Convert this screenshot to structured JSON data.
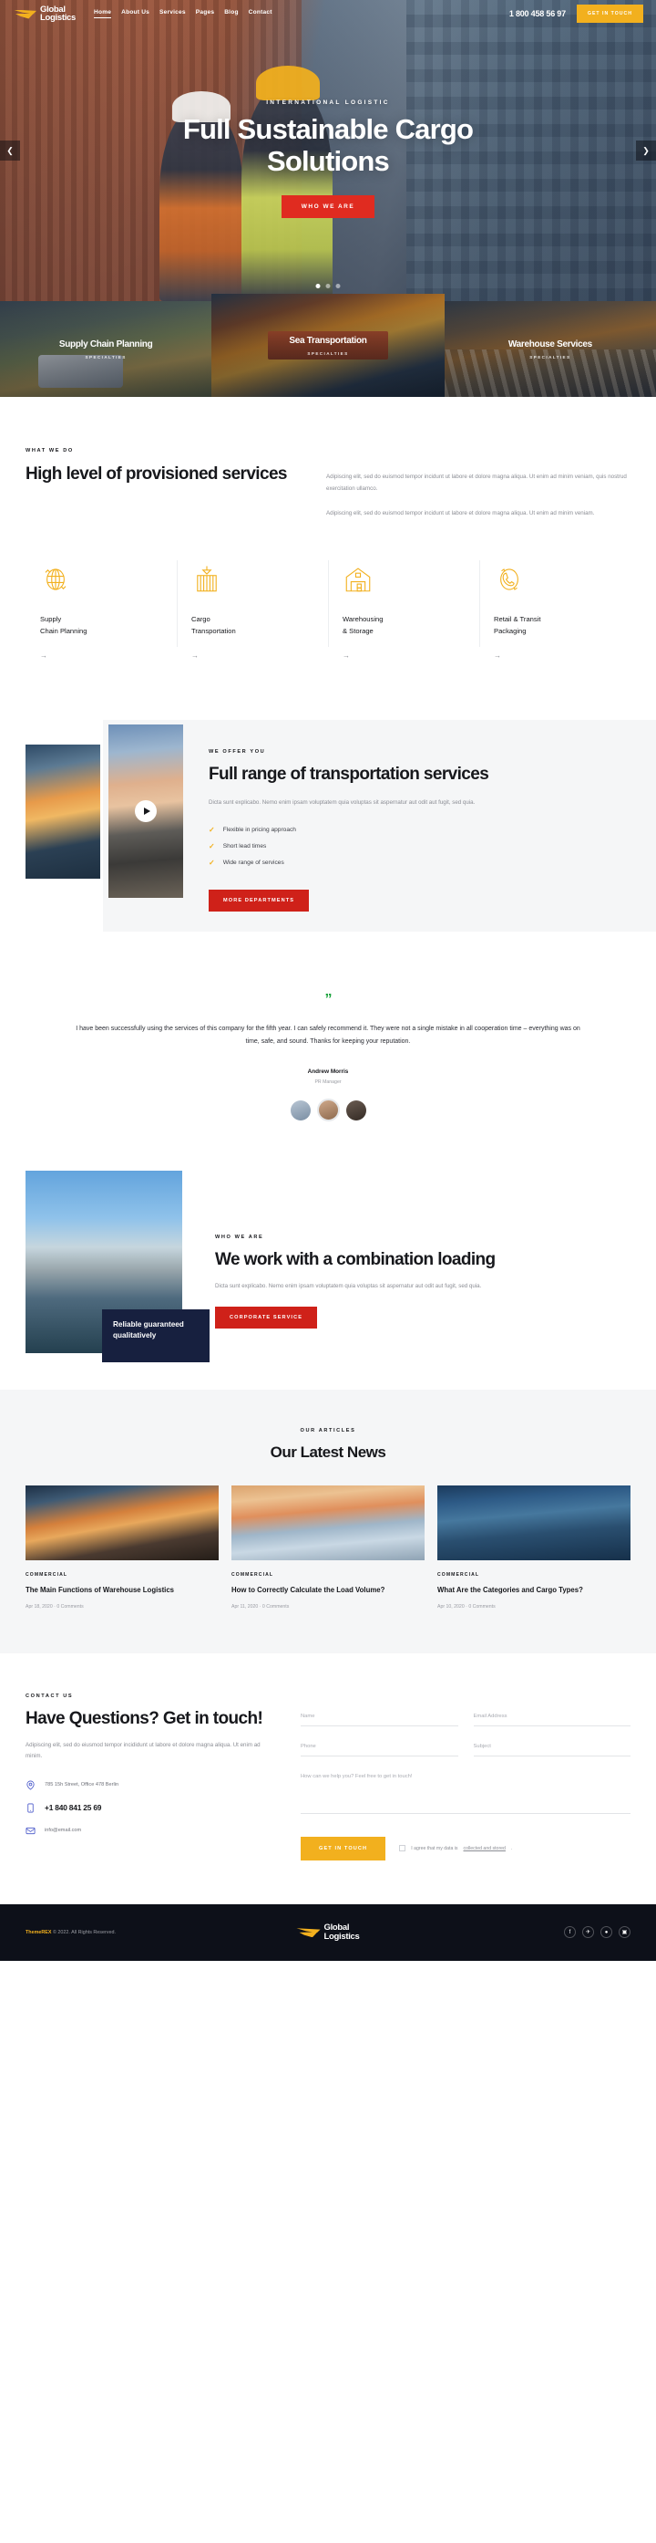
{
  "header": {
    "brand_line1": "Global",
    "brand_line2": "Logistics",
    "nav": [
      {
        "label": "Home"
      },
      {
        "label": "About Us"
      },
      {
        "label": "Services"
      },
      {
        "label": "Pages"
      },
      {
        "label": "Blog"
      },
      {
        "label": "Contact"
      }
    ],
    "phone": "1 800 458 56 97",
    "cta": "GET IN TOUCH"
  },
  "hero": {
    "kicker": "INTERNATIONAL LOGISTIC",
    "title": "Full Sustainable Cargo Solutions",
    "button": "WHO WE ARE",
    "prev_icon": "chevron-left-icon",
    "next_icon": "chevron-right-icon"
  },
  "specialties": [
    {
      "title": "Supply Chain Planning",
      "sub": "SPECIALTIES"
    },
    {
      "title": "Sea Transportation",
      "sub": "SPECIALTIES"
    },
    {
      "title": "Warehouse Services",
      "sub": "SPECIALTIES"
    }
  ],
  "what_we_do": {
    "kicker": "WHAT WE DO",
    "title": "High level of provisioned services",
    "paragraph1": "Adipiscing elit, sed do euismod tempor incidunt ut labore et dolore magna aliqua. Ut enim ad minim veniam, quis nostrud exercitation ullamco.",
    "paragraph2": "Adipiscing elit, sed do euismod tempor incidunt ut labore et dolore magna aliqua. Ut enim ad minim veniam.",
    "services": [
      {
        "icon": "globe-logistics-icon",
        "line1": "Supply",
        "line2": "Chain Planning",
        "arrow": "→"
      },
      {
        "icon": "cargo-container-icon",
        "line1": "Cargo",
        "line2": "Transportation",
        "arrow": "→"
      },
      {
        "icon": "warehouse-icon",
        "line1": "Warehousing",
        "line2": "& Storage",
        "arrow": "→"
      },
      {
        "icon": "support-24-icon",
        "line1": "Retail & Transit",
        "line2": "Packaging",
        "arrow": "→"
      }
    ]
  },
  "offer": {
    "kicker": "WE OFFER YOU",
    "title": "Full range of transportation services",
    "paragraph": "Dicta sunt explicabo. Nemo enim ipsam voluptatem quia voluptas sit aspernatur aut odit aut fugit, sed quia.",
    "features": [
      "Flexible in pricing approach",
      "Short lead times",
      "Wide range of services"
    ],
    "button": "MORE DEPARTMENTS",
    "play_icon": "play-icon"
  },
  "testimonial": {
    "quote_icon": "quote-icon",
    "text": "I have been successfully using the services of this company for the fifth year. I can safely recommend it. They were not a single mistake in all cooperation time – everything was on time, safe, and sound. Thanks for keeping your reputation.",
    "author": "Andrew Morris",
    "role": "PR Manager"
  },
  "combination": {
    "kicker": "WHO WE ARE",
    "title": "We work with a combination loading",
    "paragraph": "Dicta sunt explicabo. Nemo enim ipsam voluptatem quia voluptas sit aspernatur aut odit aut fugit, sed quia.",
    "button": "CORPORATE SERVICE",
    "card_text": "Reliable guaranteed qualitatively"
  },
  "news": {
    "kicker": "OUR ARTICLES",
    "title": "Our Latest News",
    "posts": [
      {
        "category": "COMMERCIAL",
        "title": "The Main Functions of Warehouse Logistics",
        "meta": "Apr 18, 2020  ·  0 Comments"
      },
      {
        "category": "COMMERCIAL",
        "title": "How to Correctly Calculate the Load Volume?",
        "meta": "Apr 11, 2020  ·  0 Comments"
      },
      {
        "category": "COMMERCIAL",
        "title": "What Are the Categories and Cargo Types?",
        "meta": "Apr 10, 2020  ·  0 Comments"
      }
    ]
  },
  "contact": {
    "kicker": "CONTACT US",
    "title": "Have Questions? Get in touch!",
    "paragraph": "Adipiscing elit, sed do eiusmod tempor incididunt ut labore et dolore magna aliqua. Ut enim ad minim.",
    "address": "785 15h Street, Office 478 Berlin",
    "phone": "+1 840 841 25 69",
    "email": "info@email.com",
    "address_icon": "location-pin-icon",
    "phone_icon": "mobile-phone-icon",
    "email_icon": "envelope-icon",
    "form": {
      "name_placeholder": "Name",
      "email_placeholder": "Email Address",
      "phone_placeholder": "Phone",
      "subject_placeholder": "Subject",
      "message_placeholder": "How can we help you? Feel free to get in touch!",
      "submit": "GET IN TOUCH",
      "agree_prefix": "I agree that my data is ",
      "agree_link": "collected and stored",
      "agree_suffix": "."
    }
  },
  "footer": {
    "copyright_brand": "ThemeREX",
    "copyright_rest": " © 2022. All Rights Reserved.",
    "brand_line1": "Global",
    "brand_line2": "Logistics",
    "socials": [
      {
        "icon": "facebook-icon",
        "glyph": "f"
      },
      {
        "icon": "twitter-icon",
        "glyph": "✈"
      },
      {
        "icon": "dribbble-icon",
        "glyph": "●"
      },
      {
        "icon": "instagram-icon",
        "glyph": "▣"
      }
    ]
  },
  "colors": {
    "yellow": "#f2b01e",
    "red": "#cf2119",
    "dark": "#0d1019",
    "navy": "#17203f",
    "green": "#19a23b"
  }
}
